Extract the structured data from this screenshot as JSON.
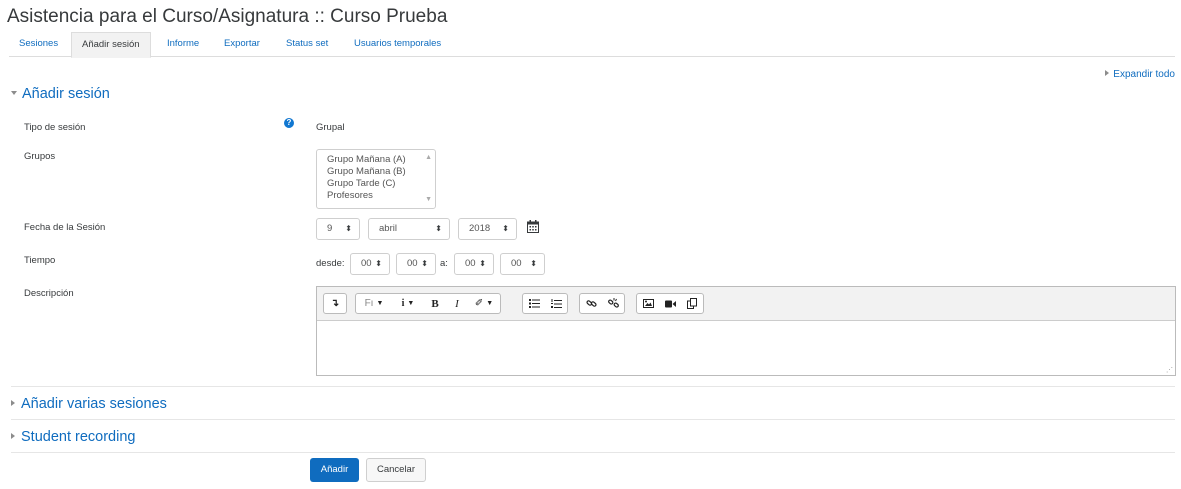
{
  "page": {
    "title": "Asistencia para el Curso/Asignatura :: Curso Prueba"
  },
  "tabs": [
    {
      "label": "Sesiones",
      "active": false
    },
    {
      "label": "Añadir sesión",
      "active": true
    },
    {
      "label": "Informe",
      "active": false
    },
    {
      "label": "Exportar",
      "active": false
    },
    {
      "label": "Status set",
      "active": false
    },
    {
      "label": "Usuarios temporales",
      "active": false
    }
  ],
  "expand_all": "Expandir todo",
  "section_add": {
    "title": "Añadir sesión",
    "session_type": {
      "label": "Tipo de sesión",
      "value": "Grupal"
    },
    "groups": {
      "label": "Grupos",
      "options": [
        "Grupo Mañana (A)",
        "Grupo Mañana (B)",
        "Grupo Tarde (C)",
        "Profesores"
      ]
    },
    "date": {
      "label": "Fecha de la Sesión",
      "day": "9",
      "month": "abril",
      "year": "2018"
    },
    "time": {
      "label": "Tiempo",
      "from_label": "desde:",
      "to_label": "a:",
      "from_hour": "00",
      "from_min": "00",
      "to_hour": "00",
      "to_min": "00"
    },
    "description": {
      "label": "Descripción",
      "toolbar": {
        "toggle": "↴",
        "font": "Fı",
        "info": "i",
        "bold": "B",
        "italic": "I",
        "brush": "✐"
      }
    }
  },
  "section_multi": {
    "title": "Añadir varias sesiones"
  },
  "section_recording": {
    "title": "Student recording"
  },
  "buttons": {
    "submit": "Añadir",
    "cancel": "Cancelar"
  },
  "colors": {
    "accent": "#0f6cbf",
    "help": "#1177d1"
  },
  "icons": [
    "help-icon",
    "calendar-icon",
    "bullet-list-icon",
    "numbered-list-icon",
    "link-icon",
    "unlink-icon",
    "image-icon",
    "video-icon",
    "manage-files-icon"
  ]
}
